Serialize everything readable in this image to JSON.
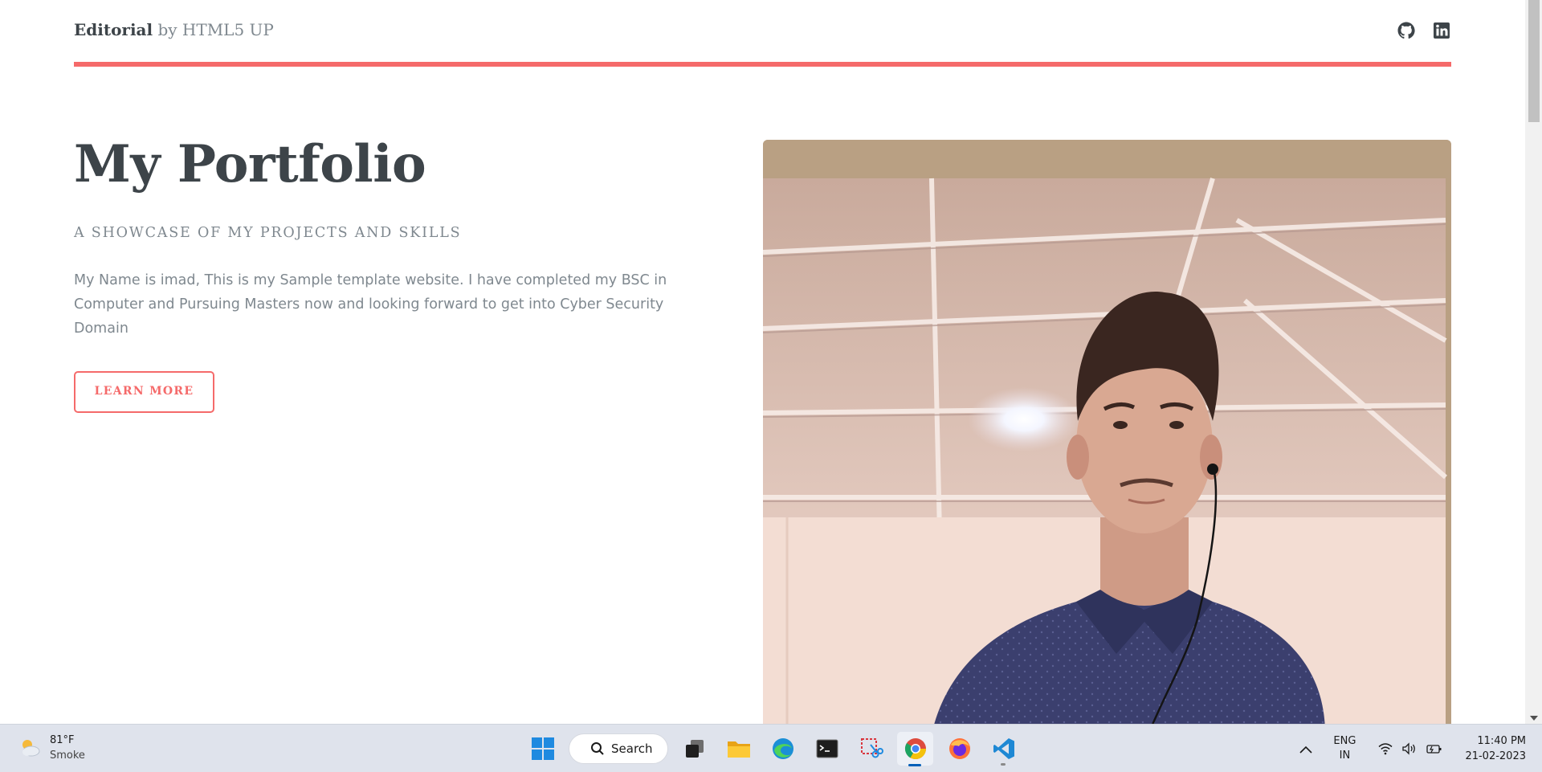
{
  "header": {
    "logo_bold": "Editorial",
    "logo_rest": " by HTML5 UP",
    "social_icons": [
      "github-icon",
      "linkedin-icon"
    ]
  },
  "banner": {
    "title": "My Portfolio",
    "subtitle": "A showcase of my projects and skills",
    "intro": "My Name is imad, This is my Sample template website. I have completed my BSC in Computer and Pursuing Masters now and looking forward to get into Cyber Security Domain",
    "button_label": "LEARN MORE"
  },
  "colors": {
    "accent": "#f56a6a",
    "heading": "#3d4449",
    "body_text": "#7f888f"
  },
  "taskbar": {
    "weather_temp": "81°F",
    "weather_desc": "Smoke",
    "search_label": "Search",
    "apps": [
      "windows-start-icon",
      "task-view-icon",
      "file-explorer-icon",
      "edge-icon",
      "terminal-icon",
      "snipping-tool-icon",
      "chrome-icon",
      "firefox-icon",
      "vscode-icon"
    ],
    "active_app": "chrome-icon",
    "lang_line1": "ENG",
    "lang_line2": "IN",
    "time": "11:40 PM",
    "date": "21-02-2023"
  }
}
